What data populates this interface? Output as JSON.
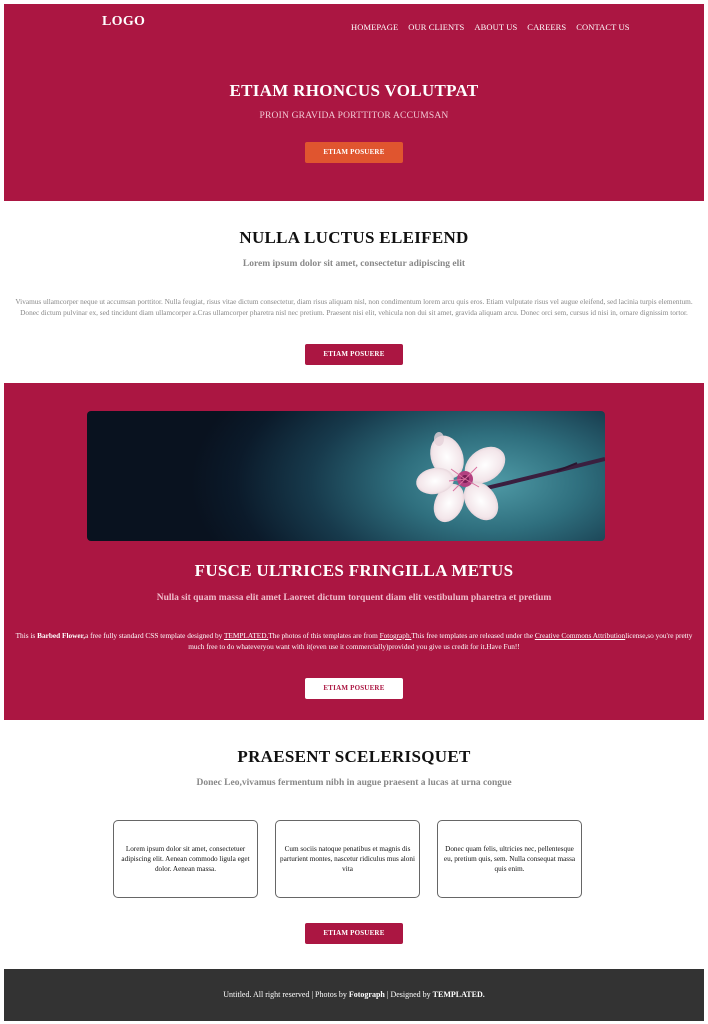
{
  "header": {
    "logo": "LOGO",
    "nav": [
      "HOMEPAGE",
      "OUR CLIENTS",
      "ABOUT US",
      "CAREERS",
      "CONTACT US"
    ],
    "title": "ETIAM RHONCUS VOLUTPAT",
    "subtitle": "PROIN GRAVIDA PORTTITOR ACCUMSAN",
    "button": "ETIAM POSUERE"
  },
  "section1": {
    "title": "NULLA LUCTUS ELEIFEND",
    "subtitle": "Lorem ipsum dolor sit amet, consectetur adipiscing elit",
    "body": "Vivamus ullamcorper neque ut accumsan porttitor. Nulla feugiat, risus vitae dictum consectetur, diam risus aliquam nisl, non condimentum lorem arcu quis eros. Etiam vulputate risus vel augue eleifend, sed lacinia turpis elementum. Donec dictum pulvinar ex, sed tincidunt diam ullamcorper a.Cras ullamcorper pharetra nisl nec pretium. Praesent nisi elit, vehicula non dui sit amet, gravida aliquam arcu. Donec orci sem, cursus id nisi in, ornare dignissim tortor.",
    "button": "ETIAM POSUERE"
  },
  "section2": {
    "image_alt": "cherry-blossom-icon",
    "title": "FUSCE ULTRICES FRINGILLA METUS",
    "subtitle": "Nulla sit quam massa elit amet Laoreet dictum torquent diam elit vestibulum pharetra et pretium",
    "body": {
      "t1": "This is ",
      "b1": "Barbed Flower,",
      "t2": "a free fully standard CSS template designed by ",
      "l1": "TEMPLATED.",
      "t3": "The photos of this templates are from ",
      "l2": "Fotograph.",
      "t4": "This free templates are released under the ",
      "l3": "Creative Commons Attribution",
      "t5": "license,so you're pretty much free to do whateveryou want with it(even use it commercially)provided you give us credit for it.Have Fun!!"
    },
    "button": "ETIAM POSUERE"
  },
  "section3": {
    "title": "PRAESENT SCELERISQUET",
    "subtitle": "Donec Leo,vivamus fermentum nibh in augue praesent a lucas at urna congue",
    "cards": [
      "Lorem ipsum dolor sit amet, consectetuer adipiscing elit. Aenean commodo ligula eget dolor. Aenean massa.",
      "Cum sociis natoque penatibus et magnis dis parturient montes, nascetur ridiculus mus aloni vita",
      "Donec quam felis, ultricies nec, pellentesque eu, pretium quis, sem. Nulla consequat massa quis enim."
    ],
    "button": "ETIAM POSUERE"
  },
  "footer": {
    "t1": "Untitled. All right reserved | Photos by ",
    "b1": "Fotograph",
    "t2": " | Designed by ",
    "b2": "TEMPLATED."
  },
  "colors": {
    "primary": "#ab1642",
    "accent_orange": "#e0552f",
    "footer": "#333333"
  }
}
